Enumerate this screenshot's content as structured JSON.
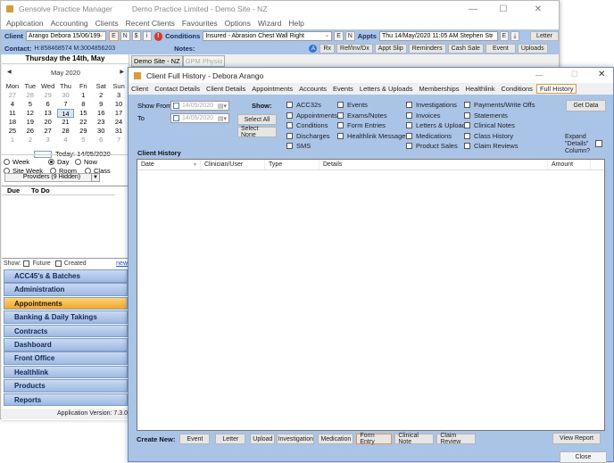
{
  "main_window": {
    "app_name": "Gensolve Practice Manager",
    "title_context": "Demo Practice Limited  - Demo Site - NZ",
    "window_controls": {
      "minimize": "—",
      "maximize": "☐",
      "close": "✕"
    },
    "menu": [
      "Application",
      "Accounting",
      "Clients",
      "Recent Clients",
      "Favourites",
      "Options",
      "Wizard",
      "Help"
    ],
    "client_bar": {
      "client_label": "Client",
      "client_value": "Arango Debora 15/06/199",
      "buttons": [
        "E",
        "N",
        "$",
        "i"
      ],
      "alert_icon": "!",
      "conditions_label": "Conditions",
      "conditions_value": "Insured - Abrasion Chest Wall Right",
      "cond_buttons": [
        "E",
        "N"
      ],
      "appts_label": "Appts",
      "appts_value": "Thu 14/May/2020 11:05 AM Stephen Str",
      "appt_buttons": [
        "E",
        "⤓"
      ],
      "letter_button": "Letter"
    },
    "contact_bar": {
      "contact_label": "Contact:",
      "contact_value": "H:858468574 M:3004856203",
      "notes_label": "Notes:",
      "a_badge": "A",
      "buttons": [
        "Rx",
        "Ref/Inv/Dx",
        "Appt Slip",
        "Reminders",
        "Cash Sale",
        "Event",
        "Uploads"
      ]
    },
    "site_tabs": [
      {
        "label": "Demo Site - NZ",
        "active": true
      },
      {
        "label": "GPM Physio",
        "active": false
      }
    ]
  },
  "left_panel": {
    "date_heading": "Thursday the 14th, May",
    "calendar": {
      "month_label": "May 2020",
      "prev": "◀",
      "next": "▶",
      "weekdays": [
        "Mon",
        "Tue",
        "Wed",
        "Thu",
        "Fri",
        "Sat",
        "Sun"
      ],
      "weeks": [
        [
          [
            "27",
            true
          ],
          [
            "28",
            true
          ],
          [
            "29",
            true
          ],
          [
            "30",
            true
          ],
          [
            "1",
            false
          ],
          [
            "2",
            false
          ],
          [
            "3",
            false
          ]
        ],
        [
          [
            "4",
            false
          ],
          [
            "5",
            false
          ],
          [
            "6",
            false
          ],
          [
            "7",
            false
          ],
          [
            "8",
            false
          ],
          [
            "9",
            false
          ],
          [
            "10",
            false
          ]
        ],
        [
          [
            "11",
            false
          ],
          [
            "12",
            false
          ],
          [
            "13",
            false
          ],
          [
            "14",
            false
          ],
          [
            "15",
            false
          ],
          [
            "16",
            false
          ],
          [
            "17",
            false
          ]
        ],
        [
          [
            "18",
            false
          ],
          [
            "19",
            false
          ],
          [
            "20",
            false
          ],
          [
            "21",
            false
          ],
          [
            "22",
            false
          ],
          [
            "23",
            false
          ],
          [
            "24",
            false
          ]
        ],
        [
          [
            "25",
            false
          ],
          [
            "26",
            false
          ],
          [
            "27",
            false
          ],
          [
            "28",
            false
          ],
          [
            "29",
            false
          ],
          [
            "30",
            false
          ],
          [
            "31",
            false
          ]
        ],
        [
          [
            "1",
            true
          ],
          [
            "2",
            true
          ],
          [
            "3",
            true
          ],
          [
            "4",
            true
          ],
          [
            "5",
            true
          ],
          [
            "6",
            true
          ],
          [
            "7",
            true
          ]
        ]
      ],
      "selected_day": "14",
      "today_label": "Today: 14/05/2020"
    },
    "view_options": [
      {
        "label": "Week",
        "checked": false
      },
      {
        "label": "Day",
        "checked": true
      },
      {
        "label": "Now",
        "checked": false
      },
      {
        "label": "Site Week",
        "checked": false
      },
      {
        "label": "Room",
        "checked": false
      },
      {
        "label": "Class",
        "checked": false
      }
    ],
    "providers_select": "Providers (9 Hidden)",
    "todo": {
      "col_due": "Due",
      "col_todo": "To Do"
    },
    "show_row": {
      "label": "Show:",
      "future": "Future",
      "created": "Created",
      "new_link": "new"
    },
    "nav_items": [
      {
        "label": "ACC45's & Batches",
        "active": false
      },
      {
        "label": "Administration",
        "active": false
      },
      {
        "label": "Appointments",
        "active": true
      },
      {
        "label": "Banking & Daily Takings",
        "active": false
      },
      {
        "label": "Contracts",
        "active": false
      },
      {
        "label": "Dashboard",
        "active": false
      },
      {
        "label": "Front Office",
        "active": false
      },
      {
        "label": "Healthlink",
        "active": false
      },
      {
        "label": "Products",
        "active": false
      },
      {
        "label": "Reports",
        "active": false
      }
    ],
    "status": "Application Version: 7.3.0"
  },
  "dialog": {
    "title": "Client Full History - Debora Arango",
    "window_controls": {
      "minimize": "—",
      "maximize": "☐",
      "close": "✕"
    },
    "tabs": [
      "Client",
      "Contact Details",
      "Client Details",
      "Appointments",
      "Accounts",
      "Events",
      "Letters & Uploads",
      "Memberships",
      "Healthlink",
      "Conditions",
      "Full History"
    ],
    "active_tab": "Full History",
    "filters": {
      "show_from_label": "Show From",
      "show_from_value": "14/05/2020",
      "to_label": "To",
      "to_value": "14/05/2020",
      "show_label": "Show:",
      "select_all": "Select All",
      "select_none": "Select None",
      "checkbox_columns": [
        [
          "ACC32s",
          "Appointments",
          "Conditions",
          "Discharges",
          "SMS"
        ],
        [
          "Events",
          "Exams/Notes",
          "Form Entries",
          "Healthlink Messages"
        ],
        [
          "Investigations",
          "Invoices",
          "Letters & Uploads",
          "Medications",
          "Product Sales"
        ],
        [
          "Payments/Write Offs",
          "Statements",
          "Clinical Notes",
          "Class History",
          "Claim Reviews"
        ]
      ],
      "get_data": "Get Data",
      "expand_details": "Expand \"Details\" Column?"
    },
    "history_label": "Client History",
    "table_columns": [
      "Date",
      "Clinician/User",
      "Type",
      "Details",
      "Amount"
    ],
    "create_new_label": "Create New:",
    "create_buttons": [
      "Event",
      "Letter",
      "Upload",
      "Investigation",
      "Medication",
      "Form Entry",
      "Clinical Note",
      "Claim Review"
    ],
    "highlighted_create": "Form Entry",
    "view_report": "View Report",
    "close": "Close"
  },
  "colors": {
    "panel_blue": "#a9c4e6",
    "highlight_orange": "#e8954a",
    "nav_active": "#f3a72b"
  }
}
